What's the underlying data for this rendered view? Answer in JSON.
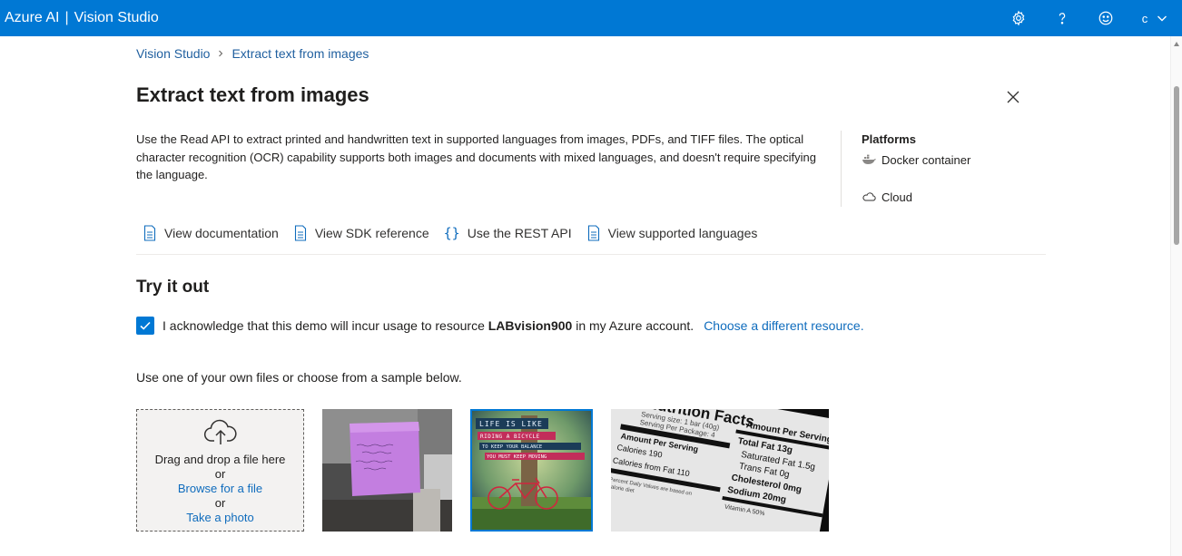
{
  "topbar": {
    "brand_part1": "Azure AI",
    "brand_sep": "|",
    "brand_part2": "Vision Studio",
    "account_initial": "c",
    "icons": [
      "gear-icon",
      "help-icon",
      "feedback-smiley-icon",
      "chevron-down-icon"
    ]
  },
  "breadcrumb": {
    "items": [
      "Vision Studio",
      "Extract text from images"
    ]
  },
  "page": {
    "title": "Extract text from images",
    "description": "Use the Read API to extract printed and handwritten text in supported languages from images, PDFs, and TIFF files. The optical character recognition (OCR) capability supports both images and documents with mixed languages, and doesn't require specifying the language."
  },
  "platforms": {
    "title": "Platforms",
    "items": [
      "Docker container",
      "Cloud"
    ]
  },
  "links": [
    "View documentation",
    "View SDK reference",
    "Use the REST API",
    "View supported languages"
  ],
  "try_it": {
    "title": "Try it out",
    "ack_prefix": "I acknowledge that this demo will incur usage to resource",
    "resource_name": "LABvision900",
    "ack_suffix": "in my Azure account.",
    "choose_link": "Choose a different resource.",
    "checked": true,
    "use_one": "Use one of your own files or choose from a sample below."
  },
  "dropzone": {
    "drag_text": "Drag and drop a file here",
    "or1": "or",
    "browse": "Browse for a file",
    "or2": "or",
    "take_photo": "Take a photo"
  },
  "samples": {
    "s2_lines": [
      "LIFE IS LIKE",
      "RIDING A BICYCLE",
      "TO KEEP YOUR BALANCE",
      "YOU MUST KEEP MOVING"
    ],
    "s3_lines": [
      "Nutrition Facts",
      "Serving size: 1 bar (40g)",
      "Serving Per Package: 4",
      "Amount Per Serving",
      "Calories 190",
      "Calories from Fat 110",
      "Percent Daily Values are based on",
      "calorie diet",
      "Amount Per Serving",
      "Total Fat 13g",
      "Saturated Fat 1.5g",
      "Trans Fat 0g",
      "Cholesterol 0mg",
      "Sodium 20mg",
      "Vitamin A 50%"
    ]
  }
}
